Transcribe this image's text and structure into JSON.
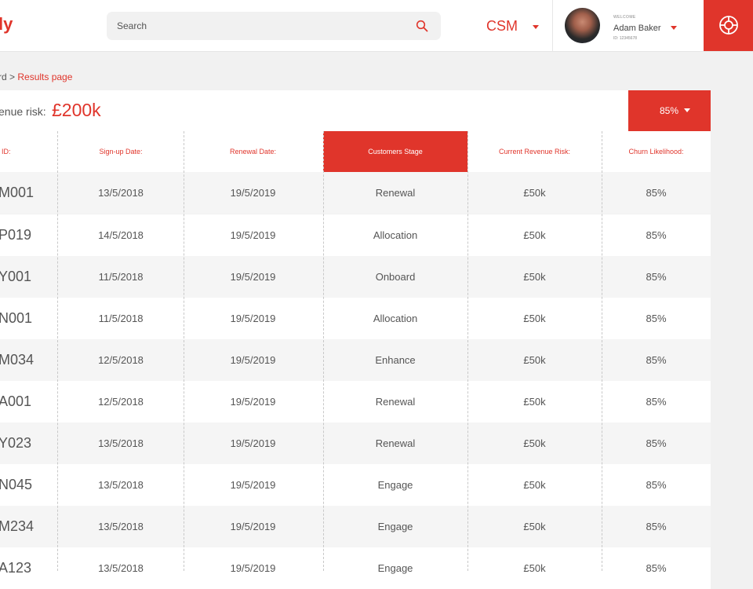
{
  "header": {
    "logo": "ly",
    "search_placeholder": "Search",
    "role": "CSM",
    "user": {
      "welcome": "WELCOME",
      "name": "Adam Baker",
      "id": "ID: 12345678"
    }
  },
  "breadcrumb": {
    "prefix": "rd > ",
    "current": "Results page"
  },
  "summary": {
    "label": "enue risk:",
    "value": "£200k",
    "filter": "85%"
  },
  "table": {
    "columns": [
      "ID:",
      "Sign-up Date:",
      "Renewal Date:",
      "Customers Stage",
      "Current Revenue Risk:",
      "Churn Likelihood:"
    ],
    "active_column": 3,
    "rows": [
      [
        "M001",
        "13/5/2018",
        "19/5/2019",
        "Renewal",
        "£50k",
        "85%"
      ],
      [
        "P019",
        "14/5/2018",
        "19/5/2019",
        "Allocation",
        "£50k",
        "85%"
      ],
      [
        "Y001",
        "11/5/2018",
        "19/5/2019",
        "Onboard",
        "£50k",
        "85%"
      ],
      [
        "N001",
        "11/5/2018",
        "19/5/2019",
        "Allocation",
        "£50k",
        "85%"
      ],
      [
        "M034",
        "12/5/2018",
        "19/5/2019",
        "Enhance",
        "£50k",
        "85%"
      ],
      [
        "A001",
        "12/5/2018",
        "19/5/2019",
        "Renewal",
        "£50k",
        "85%"
      ],
      [
        "Y023",
        "13/5/2018",
        "19/5/2019",
        "Renewal",
        "£50k",
        "85%"
      ],
      [
        "N045",
        "13/5/2018",
        "19/5/2019",
        "Engage",
        "£50k",
        "85%"
      ],
      [
        "M234",
        "13/5/2018",
        "19/5/2019",
        "Engage",
        "£50k",
        "85%"
      ],
      [
        "A123",
        "13/5/2018",
        "19/5/2019",
        "Engage",
        "£50k",
        "85%"
      ]
    ]
  },
  "colors": {
    "accent": "#e0352b",
    "text": "#555555",
    "row_alt": "#f5f5f5"
  }
}
